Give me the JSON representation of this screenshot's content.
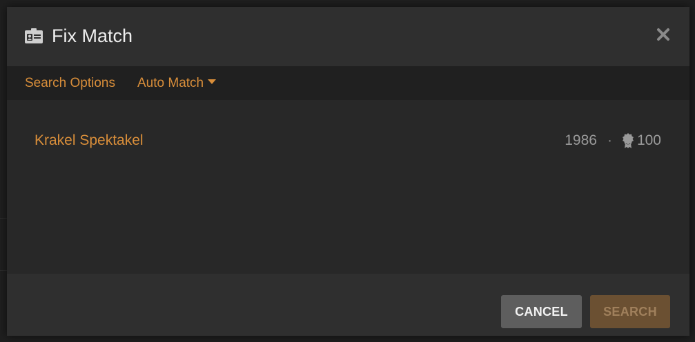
{
  "modal": {
    "title": "Fix Match",
    "header_icon": "id-card-icon",
    "close_icon": "close-icon"
  },
  "options": {
    "search_options_label": "Search Options",
    "auto_match_label": "Auto Match"
  },
  "results": [
    {
      "title": "Krakel Spektakel",
      "year": "1986",
      "separator": "·",
      "score": "100",
      "score_icon": "award-icon"
    }
  ],
  "footer": {
    "cancel_label": "CANCEL",
    "search_label": "SEARCH"
  },
  "colors": {
    "accent": "#d98e3a",
    "modal_bg": "#282828",
    "header_bg": "#2f2f2f",
    "options_bg": "#202020",
    "cancel_bg": "#5e5e5e",
    "search_bg": "#6b5032"
  }
}
